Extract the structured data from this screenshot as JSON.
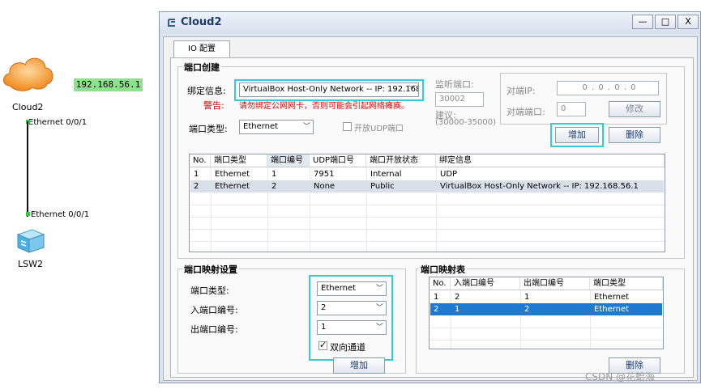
{
  "topology": {
    "cloud_label": "Cloud2",
    "switch_label": "LSW2",
    "cloud_interface": "Ethernet 0/0/1",
    "switch_interface": "Ethernet 0/0/1",
    "ip_tag": "192.168.56.1"
  },
  "window": {
    "title": "Cloud2",
    "minimize": "—",
    "maximize": "□",
    "close": "X",
    "tab": "IO 配置"
  },
  "port_create": {
    "group_title": "端口创建",
    "bind_label": "绑定信息:",
    "bind_value": "VirtualBox Host-Only Network -- IP: 192.168.56",
    "warning_label": "警告:",
    "warning_text": "请勿绑定公网网卡，否则可能会引起网络瘫痪。",
    "listen_label": "监听端口:",
    "listen_value": "30002",
    "suggest_label": "建议:",
    "suggest_range": "(30000-35000)",
    "peer_ip_label": "对端IP:",
    "peer_ip_value": "0 . 0 . 0 . 0",
    "peer_port_label": "对端端口:",
    "peer_port_value": "0",
    "modify_button": "修改",
    "port_type_label": "端口类型:",
    "port_type_value": "Ethernet",
    "udp_checkbox": "开放UDP端口",
    "add_button": "增加",
    "delete_button": "删除",
    "columns": [
      "No.",
      "端口类型",
      "端口编号",
      "UDP端口号",
      "端口开放状态",
      "绑定信息"
    ],
    "rows": [
      [
        "1",
        "Ethernet",
        "1",
        "7951",
        "Internal",
        "UDP"
      ],
      [
        "2",
        "Ethernet",
        "2",
        "None",
        "Public",
        "VirtualBox Host-Only Network -- IP: 192.168.56.1"
      ]
    ]
  },
  "mapping_settings": {
    "group_title": "端口映射设置",
    "port_type_label": "端口类型:",
    "port_type_value": "Ethernet",
    "in_port_label": "入端口编号:",
    "in_port_value": "2",
    "out_port_label": "出端口编号:",
    "out_port_value": "1",
    "bidirectional_label": "双向通道",
    "bidirectional_checked": true,
    "add_button": "增加"
  },
  "mapping_table": {
    "group_title": "端口映射表",
    "columns": [
      "No.",
      "入端口编号",
      "出端口编号",
      "端口类型"
    ],
    "rows": [
      [
        "1",
        "2",
        "1",
        "Ethernet"
      ],
      [
        "2",
        "1",
        "2",
        "Ethernet"
      ]
    ],
    "delete_button": "删除"
  },
  "watermark": "CSDN @花蛤海"
}
